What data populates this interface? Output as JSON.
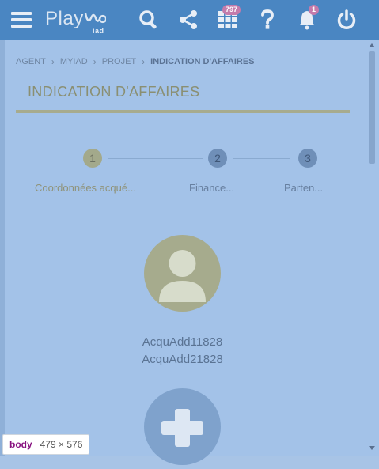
{
  "header": {
    "logo_text": "Play",
    "logo_sub": "iad",
    "tasks_badge": "797",
    "notifications_badge": "1",
    "icons": [
      "menu-icon",
      "search-icon",
      "share-icon",
      "grid-icon",
      "help-icon",
      "bell-icon",
      "power-icon"
    ]
  },
  "breadcrumb": {
    "items": [
      "AGENT",
      "MYIAD",
      "PROJET",
      "INDICATION D'AFFAIRES"
    ]
  },
  "page": {
    "title": "INDICATION D'AFFAIRES"
  },
  "steps": [
    {
      "number": "1",
      "label": "Coordonnées acqué..."
    },
    {
      "number": "2",
      "label": "Finance..."
    },
    {
      "number": "3",
      "label": "Parten..."
    }
  ],
  "contacts": [
    "AcquAdd11828",
    "AcquAdd21828"
  ],
  "devtools": {
    "tag": "body",
    "dimensions": "479 × 576"
  },
  "colors": {
    "header_bg": "#4a86c2",
    "page_bg": "#a3c2e8",
    "title_olive": "#8a8f72",
    "badge_pink": "#c47bab"
  }
}
